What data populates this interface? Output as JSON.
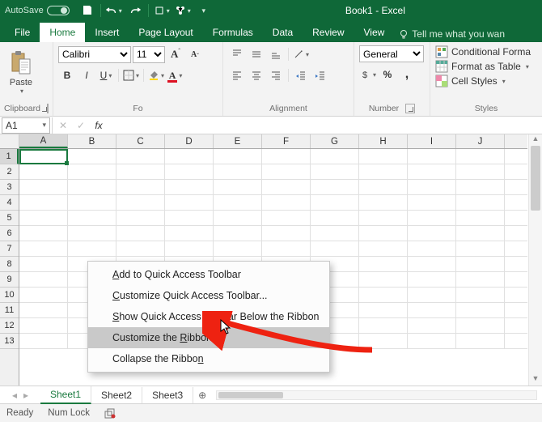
{
  "titlebar": {
    "autosave_label": "AutoSave",
    "autosave_state": "Off",
    "title": "Book1  -  Excel"
  },
  "tabs": {
    "file": "File",
    "home": "Home",
    "insert": "Insert",
    "page_layout": "Page Layout",
    "formulas": "Formulas",
    "data": "Data",
    "review": "Review",
    "view": "View",
    "tellme": "Tell me what you wan"
  },
  "ribbon": {
    "clipboard": {
      "paste": "Paste",
      "label": "Clipboard"
    },
    "font": {
      "name": "Calibri",
      "size": "11",
      "bold": "B",
      "italic": "I",
      "underline": "U",
      "label": "Fo"
    },
    "alignment": {
      "label": "Alignment"
    },
    "number": {
      "format": "General",
      "label": "Number"
    },
    "styles": {
      "cond": "Conditional Forma",
      "table": "Format as Table",
      "cells": "Cell Styles",
      "label": "Styles"
    }
  },
  "formula_bar": {
    "namebox": "A1",
    "value": ""
  },
  "grid": {
    "cols": [
      "A",
      "B",
      "C",
      "D",
      "E",
      "F",
      "G",
      "H",
      "I",
      "J"
    ],
    "rows_visible": 13,
    "active_row": 1,
    "active_col": "A"
  },
  "context_menu": {
    "items": [
      {
        "pre": "",
        "u": "A",
        "post": "dd to Quick Access Toolbar"
      },
      {
        "pre": "",
        "u": "C",
        "post": "ustomize Quick Access Toolbar..."
      },
      {
        "pre": "",
        "u": "S",
        "post": "how Quick Access Toolbar Below the Ribbon"
      },
      {
        "pre": "Customize the ",
        "u": "R",
        "post": "ibbon..."
      },
      {
        "pre": "Collapse the Ribbo",
        "u": "n",
        "post": ""
      }
    ],
    "highlighted_index": 3
  },
  "sheets": {
    "items": [
      "Sheet1",
      "Sheet2",
      "Sheet3"
    ],
    "active_index": 0
  },
  "status": {
    "ready": "Ready",
    "numlock": "Num Lock"
  }
}
